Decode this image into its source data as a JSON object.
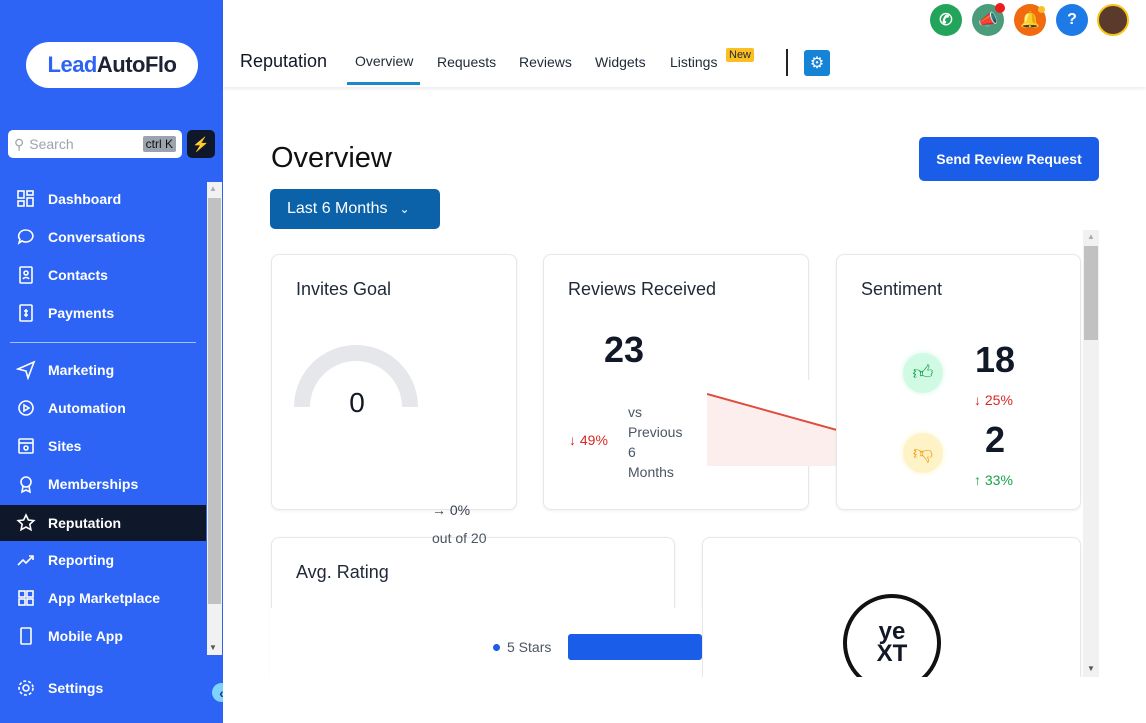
{
  "brand": {
    "part1": "Lead",
    "part2": "AutoFlo"
  },
  "search": {
    "placeholder": "Search",
    "shortcut": "ctrl K"
  },
  "sidebar": {
    "items": [
      {
        "label": "Dashboard"
      },
      {
        "label": "Conversations"
      },
      {
        "label": "Contacts"
      },
      {
        "label": "Payments"
      },
      {
        "label": "Marketing"
      },
      {
        "label": "Automation"
      },
      {
        "label": "Sites"
      },
      {
        "label": "Memberships"
      },
      {
        "label": "Reputation"
      },
      {
        "label": "Reporting"
      },
      {
        "label": "App Marketplace"
      },
      {
        "label": "Mobile App"
      }
    ],
    "settings": "Settings"
  },
  "header": {
    "title": "Reputation",
    "tabs": [
      {
        "label": "Overview"
      },
      {
        "label": "Requests"
      },
      {
        "label": "Reviews"
      },
      {
        "label": "Widgets"
      },
      {
        "label": "Listings"
      }
    ],
    "new_badge": "New"
  },
  "page": {
    "title": "Overview",
    "send_button": "Send Review Request",
    "period": "Last 6 Months"
  },
  "invites": {
    "title": "Invites Goal",
    "value": "0",
    "change": "0%",
    "out_of": "out of 20",
    "progress": 0
  },
  "reviews": {
    "title": "Reviews Received",
    "value": "23",
    "change": "49%",
    "vs": [
      "vs",
      "Previous",
      "6",
      "Months"
    ]
  },
  "sentiment": {
    "title": "Sentiment",
    "positive": "18",
    "positive_change": "25%",
    "negative": "2",
    "negative_change": "33%"
  },
  "rating": {
    "title": "Avg. Rating",
    "legend": "5 Stars"
  },
  "listings": {
    "logo": "YEXT"
  },
  "colors": {
    "sidebar": "#2d64f5",
    "primary": "#1a5de8",
    "active": "#0f172a",
    "down": "#dc2626",
    "up": "#16a34a"
  }
}
